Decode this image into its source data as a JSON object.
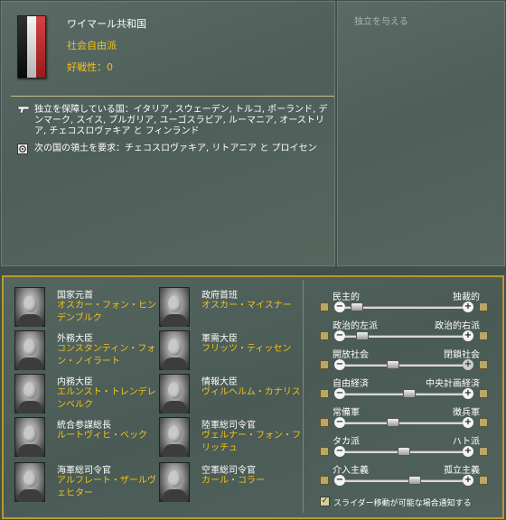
{
  "country": {
    "name": "ワイマール共和国",
    "ideology": "社会自由派",
    "belligerence": "好戦性：0",
    "flag_colors": [
      "#0d0d0d",
      "#f2f2f2",
      "#cc2222"
    ]
  },
  "guarantee": {
    "icon": "pistol-icon",
    "text": "独立を保障している国：イタリア, スウェーデン, トルコ, ポーランド, デンマーク, スイス, ブルガリア, ユーゴスラビア, ルーマニア, オーストリア, チェコスロヴァキア と フィンランド"
  },
  "claims": {
    "icon": "target-icon",
    "text": "次の国の領土を要求：チェコスロヴァキア, リトアニア と プロイセン"
  },
  "actions": {
    "grant_independence": "独立を与える"
  },
  "ministers": [
    {
      "title": "国家元首",
      "name": "オスカー・フォン・ヒンデンブルク"
    },
    {
      "title": "政府首班",
      "name": "オスカー・マイスナー"
    },
    {
      "title": "外務大臣",
      "name": "コンスタンティン・フォン・ノイラート"
    },
    {
      "title": "軍需大臣",
      "name": "フリッツ・ティッセン"
    },
    {
      "title": "内務大臣",
      "name": "エルンスト・トレンデレンベルク"
    },
    {
      "title": "情報大臣",
      "name": "ヴィルヘルム・カナリス"
    },
    {
      "title": "統合参謀総長",
      "name": "ルートヴィヒ・ベック"
    },
    {
      "title": "陸軍総司令官",
      "name": "ヴェルナー・フォン・フリッチュ"
    },
    {
      "title": "海軍総司令官",
      "name": "アルフレート・ザールヴェヒター"
    },
    {
      "title": "空軍総司令官",
      "name": "カール・コラー"
    }
  ],
  "sliders": [
    {
      "left": "民主的",
      "right": "独裁的",
      "position": 0.05
    },
    {
      "left": "政治的左派",
      "right": "政治的右派",
      "position": 0.1
    },
    {
      "left": "開放社会",
      "right": "閉鎖社会",
      "position": 0.4
    },
    {
      "left": "自由経済",
      "right": "中央計画経済",
      "position": 0.55
    },
    {
      "left": "常備軍",
      "right": "徴兵軍",
      "position": 0.4
    },
    {
      "left": "タカ派",
      "right": "ハト派",
      "position": 0.5
    },
    {
      "left": "介入主義",
      "right": "孤立主義",
      "position": 0.6
    }
  ],
  "notify": {
    "label": "スライダー移動が可能な場合通知する",
    "checked": true
  }
}
